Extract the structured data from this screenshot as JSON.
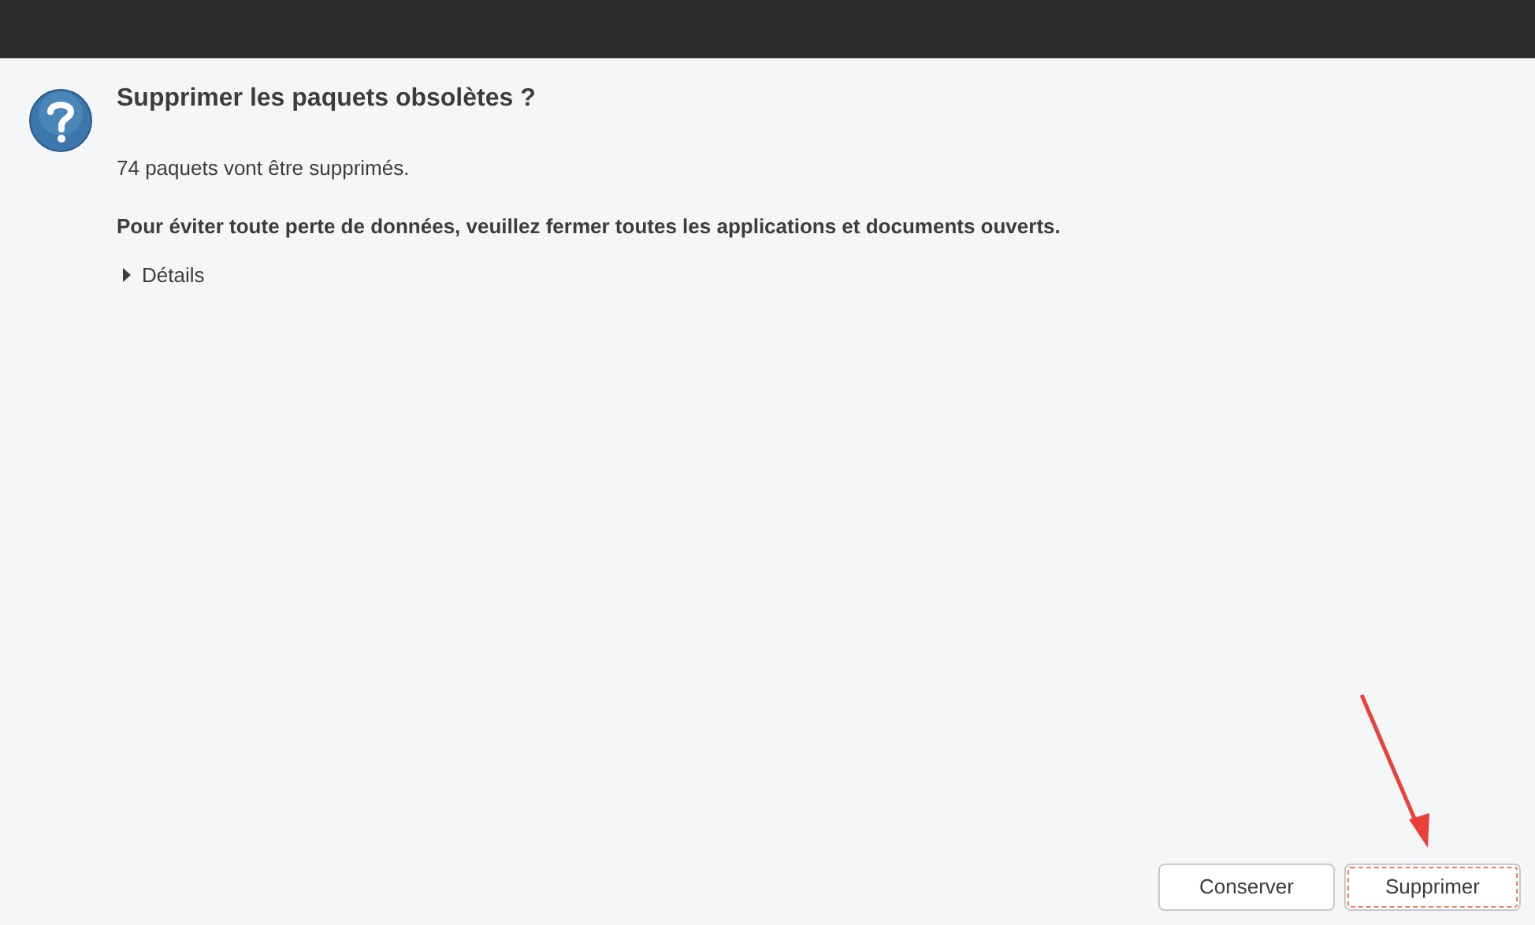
{
  "dialog": {
    "title": "Supprimer les paquets obsolètes ?",
    "message": "74 paquets vont être supprimés.",
    "warning": "Pour éviter toute perte de données, veuillez fermer toutes les applications et documents ouverts.",
    "details": {
      "label": "Détails",
      "expanded": false
    }
  },
  "buttons": [
    {
      "label": "Conserver",
      "focused": false
    },
    {
      "label": "Supprimer",
      "focused": true
    }
  ]
}
